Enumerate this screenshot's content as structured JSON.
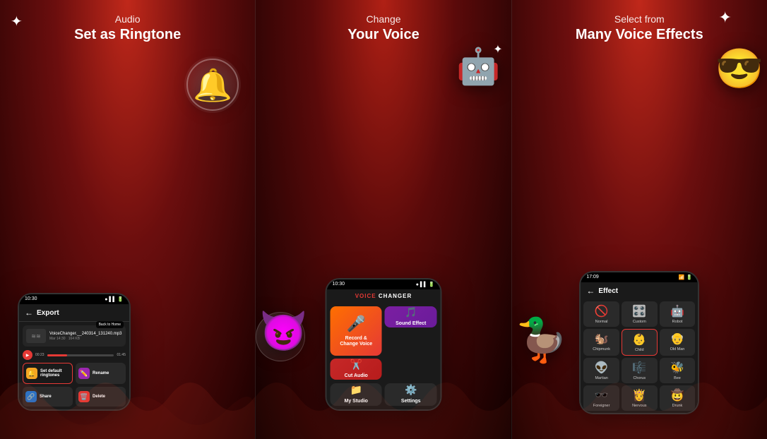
{
  "panel1": {
    "subtitle": "Audio",
    "title": "Set as Ringtone",
    "phone": {
      "status_time": "10:30",
      "header_title": "Export",
      "file_name": "VoiceChanger.__240314_131240.mp3",
      "file_date": "Mar 14:30",
      "file_size": "164 KB",
      "time_current": "00:23",
      "time_total": "01:45",
      "actions": [
        {
          "label": "Set default ringtones",
          "icon": "🔔",
          "icon_class": "icon-yellow"
        },
        {
          "label": "Rename",
          "icon": "✏️",
          "icon_class": "icon-purple"
        },
        {
          "label": "Share",
          "icon": "🔗",
          "icon_class": "icon-blue"
        },
        {
          "label": "Delete",
          "icon": "🗑️",
          "icon_class": "icon-red"
        }
      ]
    }
  },
  "panel2": {
    "subtitle": "Change",
    "title": "Your Voice",
    "phone": {
      "status_time": "10:30",
      "logo_text": "VOICE CHANGER",
      "menu_items": [
        {
          "label": "Record &\nChange Voice",
          "icon": "🎤",
          "style": "orange-red"
        },
        {
          "label": "Sound Effect",
          "icon": "🎵",
          "style": "purple"
        },
        {
          "label": "Cut Audio",
          "icon": "✂️",
          "style": "dark-red"
        },
        {
          "label": "My Studio",
          "icon": "📁",
          "style": "dark"
        },
        {
          "label": "Settings",
          "icon": "⚙️",
          "style": "dark"
        }
      ]
    }
  },
  "panel3": {
    "subtitle": "Select from",
    "title": "Many Voice Effects",
    "phone": {
      "status_time": "17:09",
      "header_title": "Effect",
      "effects": [
        {
          "label": "Normal",
          "icon": "🚫",
          "selected": false
        },
        {
          "label": "Custom",
          "icon": "🎛️",
          "selected": false
        },
        {
          "label": "Robot",
          "icon": "🤖",
          "selected": false
        },
        {
          "label": "Chipmunk",
          "icon": "🐿️",
          "selected": false
        },
        {
          "label": "Child",
          "icon": "👶",
          "selected": true
        },
        {
          "label": "Old Man",
          "icon": "👴",
          "selected": false
        },
        {
          "label": "Martian",
          "icon": "👽",
          "selected": false
        },
        {
          "label": "Chorus",
          "icon": "🎼",
          "selected": false
        },
        {
          "label": "Bee",
          "icon": "🐝",
          "selected": false
        },
        {
          "label": "Foreigner",
          "icon": "🕶️",
          "selected": false
        },
        {
          "label": "Nervous",
          "icon": "👸",
          "selected": false
        },
        {
          "label": "Drunk",
          "icon": "🤠",
          "selected": false
        }
      ]
    }
  }
}
